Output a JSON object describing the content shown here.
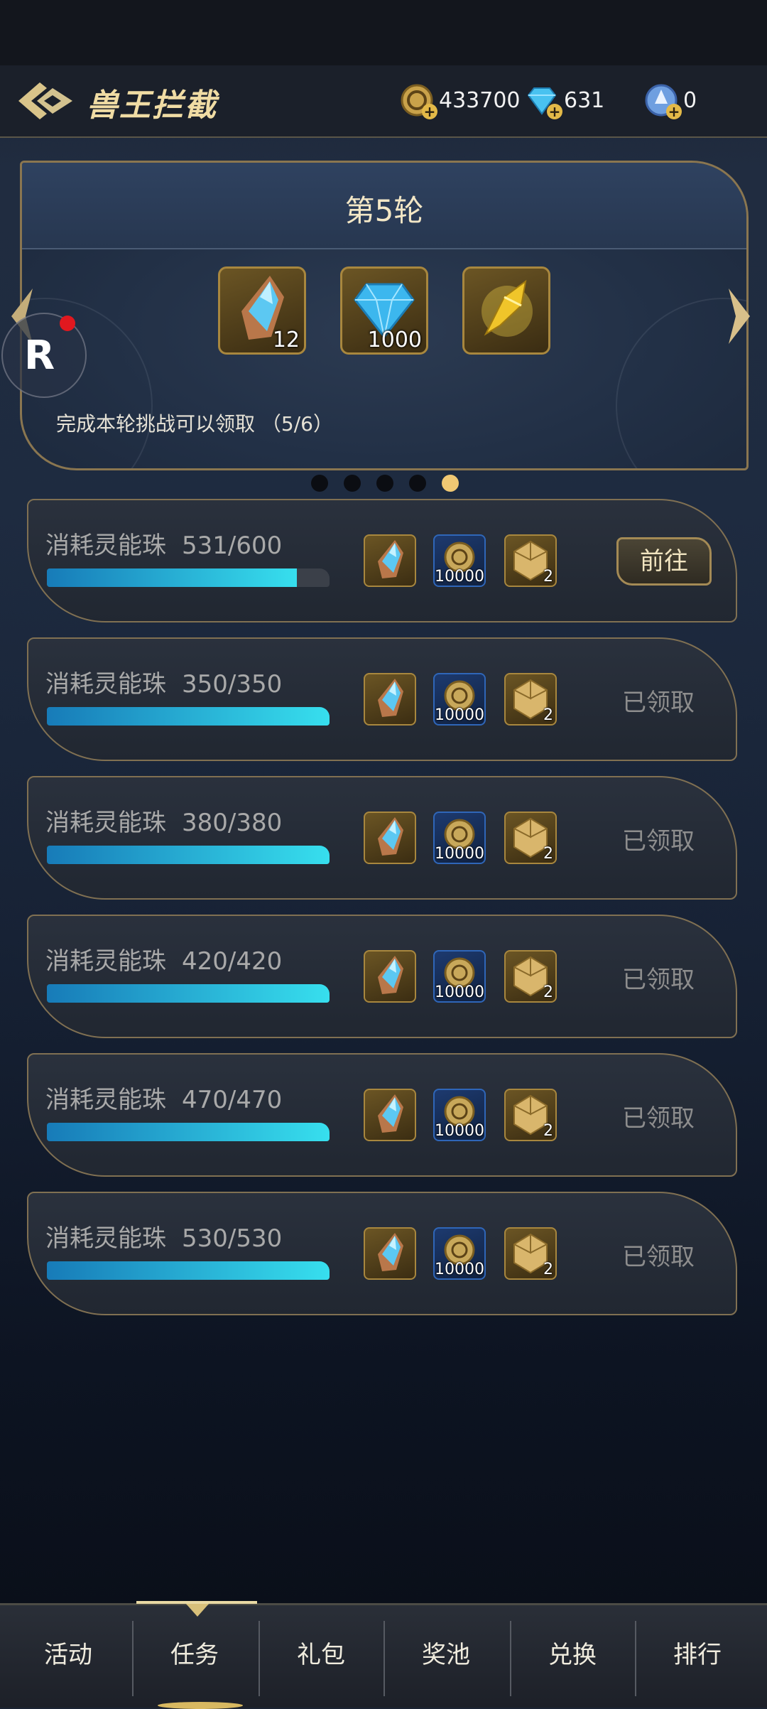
{
  "header": {
    "title": "兽王拦截",
    "currencies": [
      {
        "icon": "gold-coin-icon",
        "value": "433700"
      },
      {
        "icon": "diamond-icon",
        "value": "631"
      },
      {
        "icon": "crystal-orb-icon",
        "value": "0"
      }
    ]
  },
  "round": {
    "title": "第5轮",
    "rewards": [
      {
        "icon": "crystal-shard-icon",
        "count": "12"
      },
      {
        "icon": "diamond-gem-icon",
        "count": "1000"
      },
      {
        "icon": "gold-feather-icon",
        "count": ""
      }
    ],
    "hint": "完成本轮挑战可以领取 （5/6）",
    "page_count": 5,
    "page_active": 5
  },
  "tasks": [
    {
      "label": "消耗灵能珠",
      "progress": "531/600",
      "fraction": 0.885,
      "coin_count": "10000",
      "dice_count": "2",
      "action": "前往",
      "action_type": "go"
    },
    {
      "label": "消耗灵能珠",
      "progress": "350/350",
      "fraction": 1.0,
      "coin_count": "10000",
      "dice_count": "2",
      "action": "已领取",
      "action_type": "claimed"
    },
    {
      "label": "消耗灵能珠",
      "progress": "380/380",
      "fraction": 1.0,
      "coin_count": "10000",
      "dice_count": "2",
      "action": "已领取",
      "action_type": "claimed"
    },
    {
      "label": "消耗灵能珠",
      "progress": "420/420",
      "fraction": 1.0,
      "coin_count": "10000",
      "dice_count": "2",
      "action": "已领取",
      "action_type": "claimed"
    },
    {
      "label": "消耗灵能珠",
      "progress": "470/470",
      "fraction": 1.0,
      "coin_count": "10000",
      "dice_count": "2",
      "action": "已领取",
      "action_type": "claimed"
    },
    {
      "label": "消耗灵能珠",
      "progress": "530/530",
      "fraction": 1.0,
      "coin_count": "10000",
      "dice_count": "2",
      "action": "已领取",
      "action_type": "claimed"
    }
  ],
  "tabs": [
    "活动",
    "任务",
    "礼包",
    "奖池",
    "兑换",
    "排行"
  ],
  "active_tab": "任务"
}
